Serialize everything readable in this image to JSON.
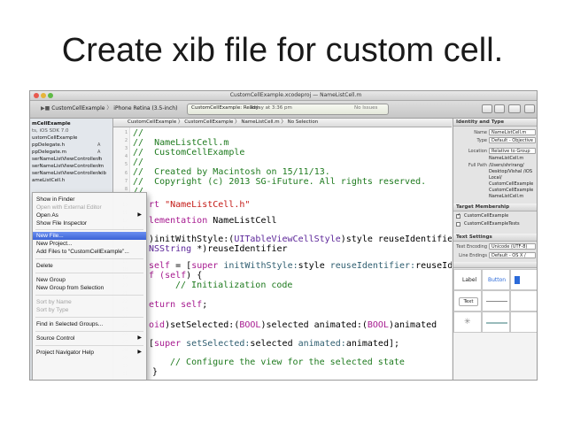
{
  "slide": {
    "title": "Create xib file for custom cell."
  },
  "window": {
    "title": "CustomCellExample.xcodeproj — NameListCell.m"
  },
  "toolbar": {
    "scheme": "CustomCellExample",
    "destination": "iPhone Retina (3.5-inch)",
    "status": "CustomCellExample: Ready",
    "time": "Today at 3:36 pm",
    "issues": "No Issues"
  },
  "navigator": {
    "items": [
      {
        "label": "mCellExample",
        "badge": ""
      },
      {
        "label": "ts, iOS SDK 7.0",
        "badge": ""
      },
      {
        "label": "ustomCellExample",
        "badge": ""
      },
      {
        "label": "ppDelegate.h",
        "badge": "A"
      },
      {
        "label": "ppDelegate.m",
        "badge": "A"
      },
      {
        "label": "serNameListViewController.h",
        "badge": "A"
      },
      {
        "label": "serNameListViewController.m",
        "badge": "A"
      },
      {
        "label": "serNameListViewController.xib",
        "badge": "A"
      },
      {
        "label": "ameListCell.h",
        "badge": ""
      }
    ]
  },
  "jumpbar": {
    "path": "CustomCellExample 〉 CustomCellExample 〉 NameListCell.m 〉 No Selection"
  },
  "editor": {
    "line_numbers": [
      "1",
      "2",
      "3",
      "4",
      "5",
      "6",
      "7",
      "8",
      "9",
      "10",
      "11",
      "12",
      "13",
      "14",
      "15",
      "16",
      "17",
      "18",
      "19",
      "20",
      "21",
      "22",
      "23",
      "24",
      "25",
      "26",
      "27",
      "28",
      "29",
      "30",
      "31"
    ],
    "lines": {
      "l1": "//",
      "l2": "//  NameListCell.m",
      "l3": "//  CustomCellExample",
      "l4": "//",
      "l5": "//  Created by Macintosh on 15/11/13.",
      "l6": "//  Copyright (c) 2013 SG-iFuture. All rights reserved.",
      "l7": "//",
      "l8_a": "rt ",
      "l8_b": "\"NameListCell.h\"",
      "l9_a": "lementation",
      "l9_b": " NameListCell",
      "l10_a": ")initWithStyle:(",
      "l10_b": "UITableViewCellStyle",
      "l10_c": ")style reuseIdentifier:",
      "l11_a": "NSString",
      "l11_b": " *)reuseIdentifier",
      "l12_a": "self",
      "l12_b": " = [",
      "l12_c": "super",
      "l12_d": " initWithStyle:",
      "l12_e": "style",
      "l12_f": " reuseIdentifier:",
      "l12_g": "reuseIdentifier];",
      "l13_a": "f (",
      "l13_b": "self",
      "l13_c": ") {",
      "l14": "// Initialization code",
      "l15": "",
      "l16_a": "eturn ",
      "l16_b": "self",
      "l16_c": ";",
      "l17_a": "oid",
      "l17_b": ")setSelected:(",
      "l17_c": "BOOL",
      "l17_d": ")selected animated:(",
      "l17_e": "BOOL",
      "l17_f": ")animated",
      "l18_a": "super",
      "l18_b": " setSelected:",
      "l18_c": "selected",
      "l18_d": " animated:",
      "l18_e": "animated",
      "l18_f": "];",
      "l19": "// Configure the view for the selected state",
      "l20": "}"
    }
  },
  "context_menu": {
    "items": [
      {
        "label": "Show in Finder",
        "state": "normal"
      },
      {
        "label": "Open with External Editor",
        "state": "disabled"
      },
      {
        "label": "Open As",
        "state": "normal"
      },
      {
        "label": "Show File Inspector",
        "state": "normal"
      },
      {
        "label": "New File...",
        "state": "selected"
      },
      {
        "label": "New Project...",
        "state": "normal"
      },
      {
        "label": "Add Files to “CustomCellExample”...",
        "state": "normal"
      },
      {
        "label": "Delete",
        "state": "normal"
      },
      {
        "label": "New Group",
        "state": "normal"
      },
      {
        "label": "New Group from Selection",
        "state": "normal"
      },
      {
        "label": "Sort by Name",
        "state": "disabled"
      },
      {
        "label": "Sort by Type",
        "state": "disabled"
      },
      {
        "label": "Find in Selected Groups...",
        "state": "normal"
      },
      {
        "label": "Source Control",
        "state": "normal"
      },
      {
        "label": "Project Navigator Help",
        "state": "normal"
      }
    ]
  },
  "inspector": {
    "identity_header": "Identity and Type",
    "name_label": "Name",
    "name_value": "NameListCell.m",
    "type_label": "Type",
    "type_value": "Default - Objective",
    "location_label": "Location",
    "location_value": "Relative to Group",
    "location_file": "NameListCell.m",
    "fullpath_label": "Full Path",
    "fullpath_lines": [
      "/Users/shrirang/",
      "Desktop/Vishal /iOS",
      "Local/",
      "CustomCellExample",
      "CustomCellExample",
      "NameListCell.m"
    ],
    "membership_header": "Target Membership",
    "target1": "CustomCellExample",
    "target2": "CustomCellExampleTests",
    "text_header": "Text Settings",
    "encoding_label": "Text Encoding",
    "encoding_value": "Unicode (UTF-8)",
    "line_endings_label": "Line Endings",
    "line_endings_value": "Default - OS X /",
    "lib_label": "Label",
    "lib_button": "Button",
    "lib_text": "Text"
  }
}
